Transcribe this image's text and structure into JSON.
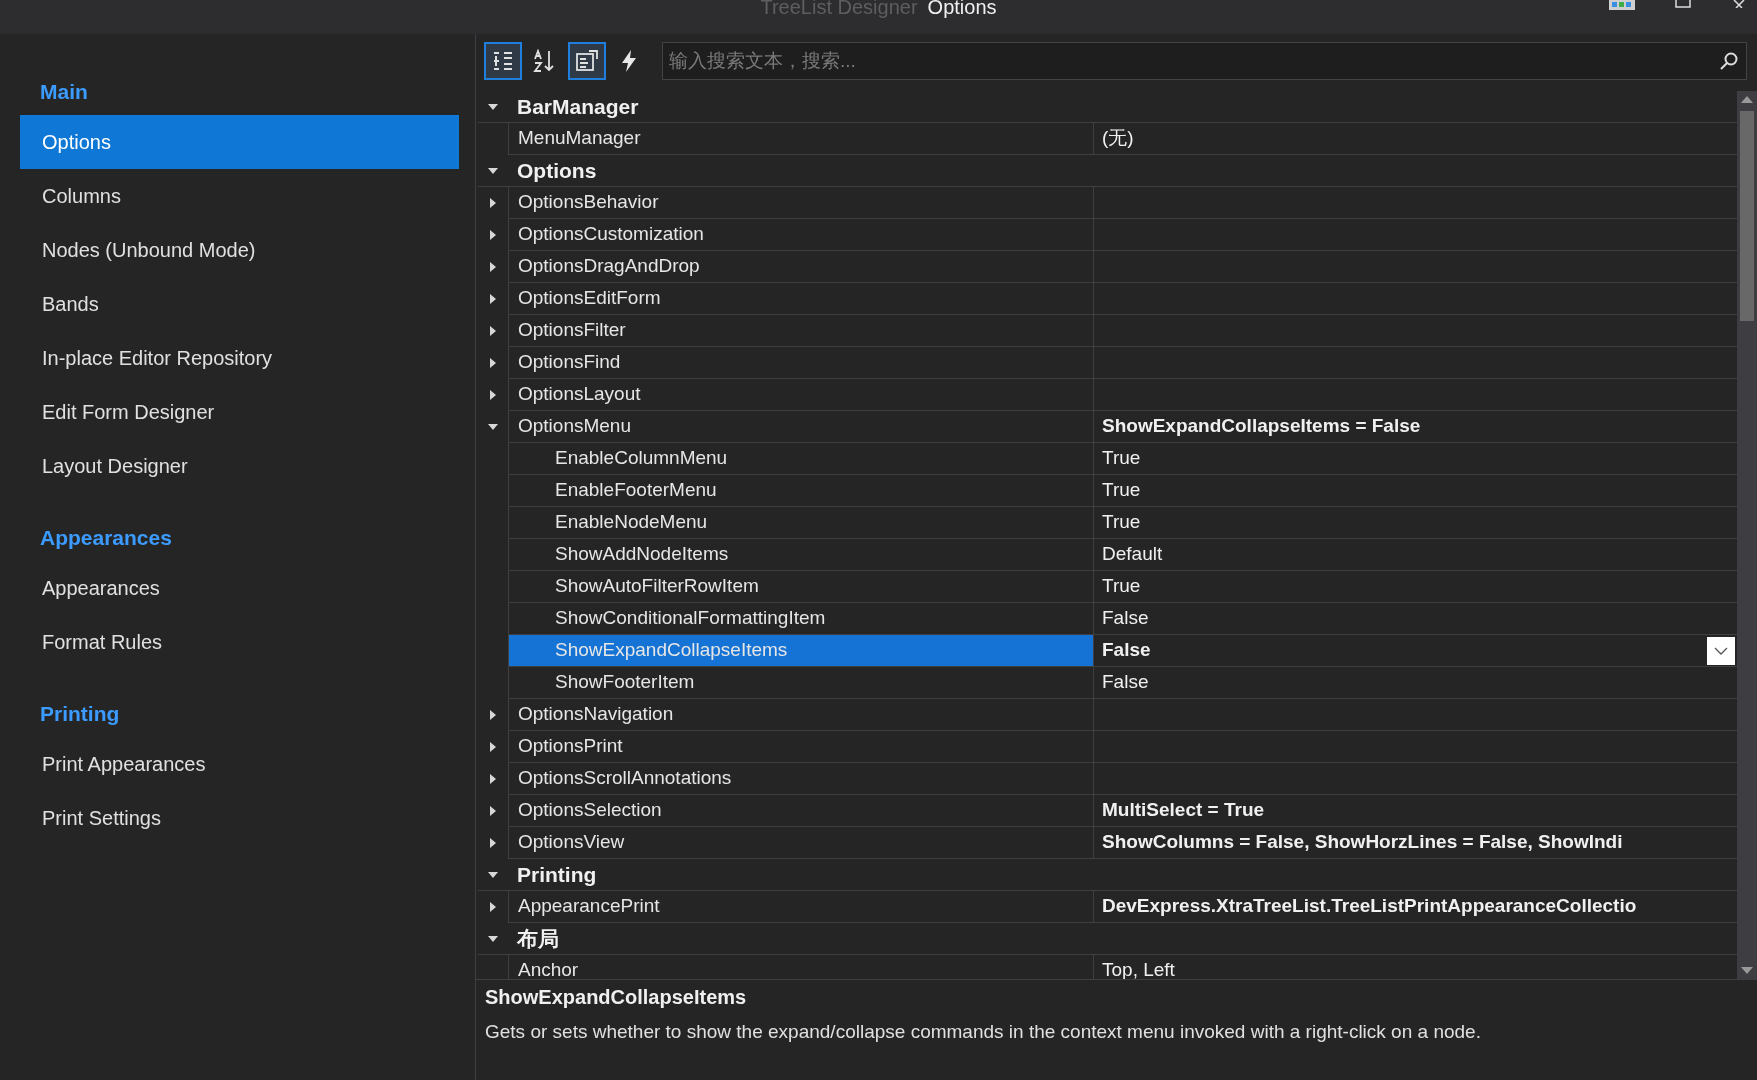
{
  "window": {
    "title_prefix": "TreeList Designer",
    "title": "Options"
  },
  "sidebar": {
    "groups": [
      {
        "header": "Main",
        "items": [
          {
            "label": "Options",
            "selected": true
          },
          {
            "label": "Columns",
            "selected": false
          },
          {
            "label": "Nodes (Unbound Mode)",
            "selected": false
          },
          {
            "label": "Bands",
            "selected": false
          },
          {
            "label": "In-place Editor Repository",
            "selected": false
          },
          {
            "label": "Edit Form Designer",
            "selected": false
          },
          {
            "label": "Layout Designer",
            "selected": false
          }
        ]
      },
      {
        "header": "Appearances",
        "items": [
          {
            "label": "Appearances",
            "selected": false
          },
          {
            "label": "Format Rules",
            "selected": false
          }
        ]
      },
      {
        "header": "Printing",
        "items": [
          {
            "label": "Print Appearances",
            "selected": false
          },
          {
            "label": "Print Settings",
            "selected": false
          }
        ]
      }
    ]
  },
  "toolbar": {
    "buttons": [
      {
        "kind": "categorized",
        "selected": true
      },
      {
        "kind": "alphabetical",
        "selected": false
      },
      {
        "kind": "properties",
        "selected": true
      },
      {
        "kind": "events",
        "selected": false
      }
    ],
    "search": {
      "placeholder": "输入搜索文本，搜索..."
    }
  },
  "grid": {
    "categories": [
      {
        "name": "BarManager",
        "expanded": true,
        "children": [
          {
            "name": "MenuManager",
            "value": "(无)",
            "selected": false
          }
        ]
      },
      {
        "name": "Options",
        "expanded": true,
        "children": [
          {
            "expanded": false,
            "name": "OptionsBehavior",
            "selected": false
          },
          {
            "expanded": false,
            "name": "OptionsCustomization",
            "selected": false
          },
          {
            "expanded": false,
            "name": "OptionsDragAndDrop",
            "selected": false
          },
          {
            "expanded": false,
            "name": "OptionsEditForm",
            "selected": false
          },
          {
            "expanded": false,
            "name": "OptionsFilter",
            "selected": false
          },
          {
            "expanded": false,
            "name": "OptionsFind",
            "selected": false
          },
          {
            "expanded": false,
            "name": "OptionsLayout",
            "selected": false
          },
          {
            "expanded": true,
            "name": "OptionsMenu",
            "value": "ShowExpandCollapseItems = False",
            "modified": true,
            "selected": false,
            "children": [
              {
                "name": "EnableColumnMenu",
                "value": "True",
                "modified": false,
                "selected": false
              },
              {
                "name": "EnableFooterMenu",
                "value": "True",
                "modified": false,
                "selected": false
              },
              {
                "name": "EnableNodeMenu",
                "value": "True",
                "modified": false,
                "selected": false
              },
              {
                "name": "ShowAddNodeItems",
                "value": "Default",
                "modified": false,
                "selected": false
              },
              {
                "name": "ShowAutoFilterRowItem",
                "value": "True",
                "modified": false,
                "selected": false
              },
              {
                "name": "ShowConditionalFormattingItem",
                "value": "False",
                "modified": false,
                "selected": false
              },
              {
                "name": "ShowExpandCollapseItems",
                "value": "False",
                "modified": true,
                "selected": true
              },
              {
                "name": "ShowFooterItem",
                "value": "False",
                "modified": false,
                "selected": false
              }
            ]
          },
          {
            "expanded": false,
            "name": "OptionsNavigation",
            "selected": false
          },
          {
            "expanded": false,
            "name": "OptionsPrint",
            "selected": false
          },
          {
            "expanded": false,
            "name": "OptionsScrollAnnotations",
            "selected": false
          },
          {
            "expanded": false,
            "name": "OptionsSelection",
            "value": "MultiSelect = True",
            "modified": true,
            "selected": false
          },
          {
            "expanded": false,
            "name": "OptionsView",
            "value": "ShowColumns = False, ShowHorzLines = False, ShowIndi",
            "modified": true,
            "selected": false
          }
        ]
      },
      {
        "name": "Printing",
        "expanded": true,
        "children": [
          {
            "expanded": false,
            "name": "AppearancePrint",
            "value": "DevExpress.XtraTreeList.TreeListPrintAppearanceCollectio",
            "modified": true,
            "selected": false
          }
        ]
      },
      {
        "name": "布局",
        "expanded": true,
        "children": [
          {
            "name": "Anchor",
            "value": "Top, Left",
            "modified": false,
            "selected": false
          }
        ]
      }
    ]
  },
  "description": {
    "title": "ShowExpandCollapseItems",
    "text": "Gets or sets whether to show the expand/collapse commands in the context menu invoked with a right-click on a node."
  }
}
